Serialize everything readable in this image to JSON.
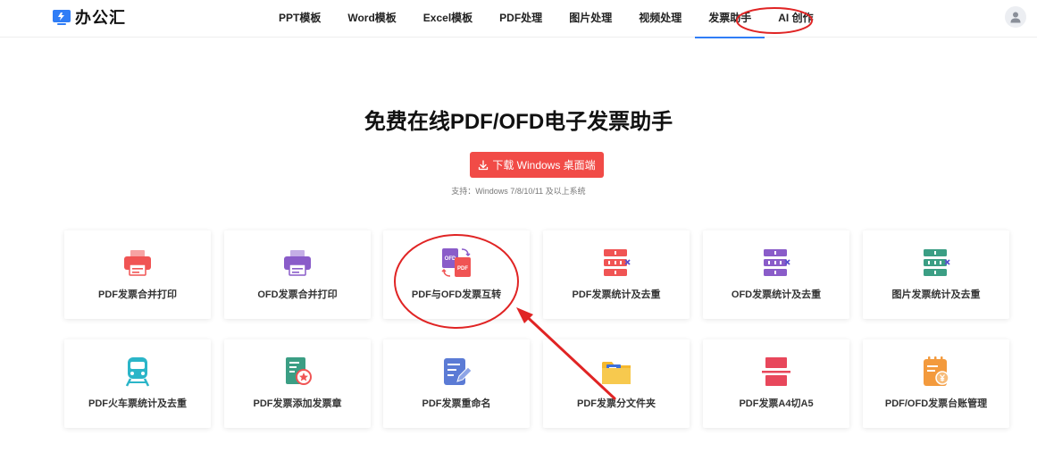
{
  "header": {
    "logo_text": "办公汇",
    "nav": [
      {
        "label": "PPT模板"
      },
      {
        "label": "Word模板"
      },
      {
        "label": "Excel模板"
      },
      {
        "label": "PDF处理"
      },
      {
        "label": "图片处理"
      },
      {
        "label": "视频处理"
      },
      {
        "label": "发票助手",
        "active": true
      },
      {
        "label": "AI 创作"
      }
    ],
    "avatar_icon": "user-icon"
  },
  "hero": {
    "title": "免费在线PDF/OFD电子发票助手",
    "download_label": "下载 Windows 桌面端",
    "download_icon": "download-icon",
    "support_text": "支持：Windows 7/8/10/11 及以上系统",
    "button_color": "#f14b47"
  },
  "tools": [
    {
      "label": "PDF发票合并打印",
      "icon": "printer-icon",
      "color": "#f05454"
    },
    {
      "label": "OFD发票合并打印",
      "icon": "printer-icon",
      "color": "#8a5cc9"
    },
    {
      "label": "PDF与OFD发票互转",
      "icon": "convert-icon",
      "color": "#8a5cc9"
    },
    {
      "label": "PDF发票统计及去重",
      "icon": "dedupe-icon",
      "color": "#f05454"
    },
    {
      "label": "OFD发票统计及去重",
      "icon": "dedupe-icon",
      "color": "#8a5cc9"
    },
    {
      "label": "图片发票统计及去重",
      "icon": "dedupe-icon",
      "color": "#3b9e84"
    },
    {
      "label": "PDF火车票统计及去重",
      "icon": "train-icon",
      "color": "#2bb5c8"
    },
    {
      "label": "PDF发票添加发票章",
      "icon": "stamp-doc-icon",
      "color": "#3b9e84"
    },
    {
      "label": "PDF发票重命名",
      "icon": "rename-icon",
      "color": "#5b7bd5"
    },
    {
      "label": "PDF发票分文件夹",
      "icon": "folder-icon",
      "color": "#f5b82e"
    },
    {
      "label": "PDF发票A4切A5",
      "icon": "split-icon",
      "color": "#e8475b"
    },
    {
      "label": "PDF/OFD发票台账管理",
      "icon": "ledger-icon",
      "color": "#f39a3d"
    }
  ],
  "annotation_color": "#e02424"
}
